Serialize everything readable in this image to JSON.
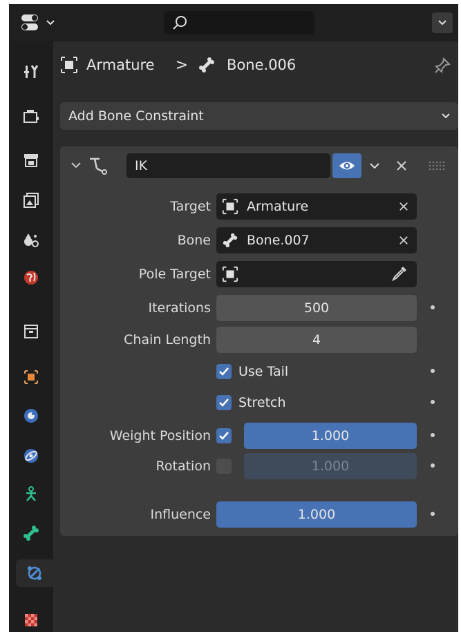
{
  "colors": {
    "accent": "#4772b3",
    "panel": "#3d3d3d",
    "field": "#1f1f1f"
  },
  "topbar": {
    "search_placeholder": "",
    "editor_icon": "properties-editor-icon"
  },
  "sidebar": {
    "tabs": [
      {
        "name": "tool-tab-icon"
      },
      {
        "name": "render-tab-icon"
      },
      {
        "name": "output-tab-icon"
      },
      {
        "name": "view-layer-tab-icon"
      },
      {
        "name": "scene-tab-icon"
      },
      {
        "name": "world-tab-icon"
      },
      {
        "name": "collection-tab-icon"
      },
      {
        "name": "object-tab-icon"
      },
      {
        "name": "modifier-tab-icon"
      },
      {
        "name": "physics-tab-icon"
      },
      {
        "name": "object-constraint-tab-icon"
      },
      {
        "name": "bone-tab-icon"
      },
      {
        "name": "bone-constraint-tab-icon"
      },
      {
        "name": "texture-tab-icon"
      }
    ]
  },
  "breadcrumb": {
    "object": "Armature",
    "separator": ">",
    "bone": "Bone.006"
  },
  "add_constraint": {
    "label": "Add Bone Constraint"
  },
  "constraint": {
    "name": "IK",
    "target": {
      "label": "Target",
      "value": "Armature"
    },
    "bone": {
      "label": "Bone",
      "value": "Bone.007"
    },
    "pole_target": {
      "label": "Pole Target",
      "value": ""
    },
    "iterations": {
      "label": "Iterations",
      "value": "500"
    },
    "chain_length": {
      "label": "Chain Length",
      "value": "4"
    },
    "use_tail": {
      "label": "Use Tail",
      "checked": true
    },
    "stretch": {
      "label": "Stretch",
      "checked": true
    },
    "weight_position": {
      "label": "Weight Position",
      "checked": true,
      "value": "1.000"
    },
    "rotation": {
      "label": "Rotation",
      "checked": false,
      "value": "1.000"
    },
    "influence": {
      "label": "Influence",
      "value": "1.000"
    }
  }
}
